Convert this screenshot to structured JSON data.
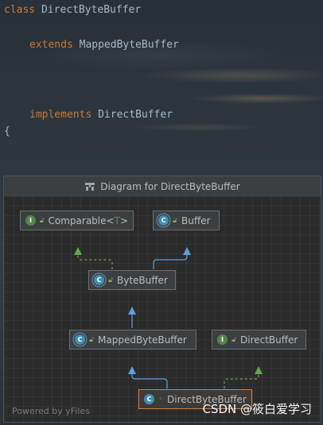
{
  "code": {
    "line1": {
      "keyword": "class",
      "name": "DirectByteBuffer"
    },
    "line2": {
      "keyword": "extends",
      "name": "MappedByteBuffer"
    },
    "line3": {
      "keyword": "implements",
      "name": "DirectBuffer"
    },
    "line4": "{"
  },
  "popup": {
    "title": "Diagram for DirectByteBuffer",
    "icon": "diagram-icon",
    "powered_by": "Powered by yFiles"
  },
  "nodes": {
    "comparable": {
      "badge": "I",
      "name": "Comparable",
      "type_open": "<",
      "type_param": "T",
      "type_close": ">",
      "kind": "interface"
    },
    "buffer": {
      "badge": "C",
      "name": "Buffer",
      "kind": "abstract-class"
    },
    "bytebuffer": {
      "badge": "C",
      "name": "ByteBuffer",
      "kind": "abstract-class"
    },
    "mappedbytebuffer": {
      "badge": "C",
      "name": "MappedByteBuffer",
      "kind": "abstract-class"
    },
    "directbuffer": {
      "badge": "I",
      "name": "DirectBuffer",
      "kind": "interface"
    },
    "directbytebuffer": {
      "badge": "C",
      "name": "DirectByteBuffer",
      "kind": "class"
    }
  },
  "colors": {
    "keyword": "#cc7832",
    "identifier": "#a9b7c6",
    "extends_link": "#5f9fde",
    "implements_link": "#5fa84c",
    "selected_border": "#d4803c"
  },
  "watermark": "CSDN @筱白爱学习"
}
